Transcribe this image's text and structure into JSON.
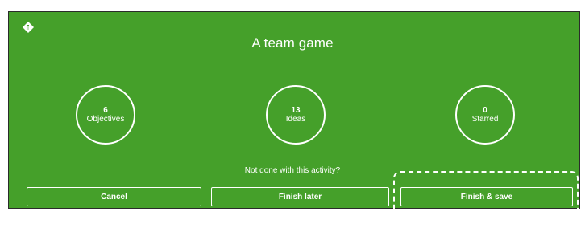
{
  "activity": {
    "title": "A team game"
  },
  "stats": [
    {
      "value": "6",
      "label": "Objectives"
    },
    {
      "value": "13",
      "label": "Ideas"
    },
    {
      "value": "0",
      "label": "Starred"
    }
  ],
  "prompt": "Not done with this activity?",
  "buttons": {
    "cancel": "Cancel",
    "finish_later": "Finish later",
    "finish_save": "Finish & save"
  },
  "icons": {
    "logo": "diamond-logo-icon"
  },
  "colors": {
    "panel_background": "#45a02a",
    "foreground": "#ffffff"
  }
}
